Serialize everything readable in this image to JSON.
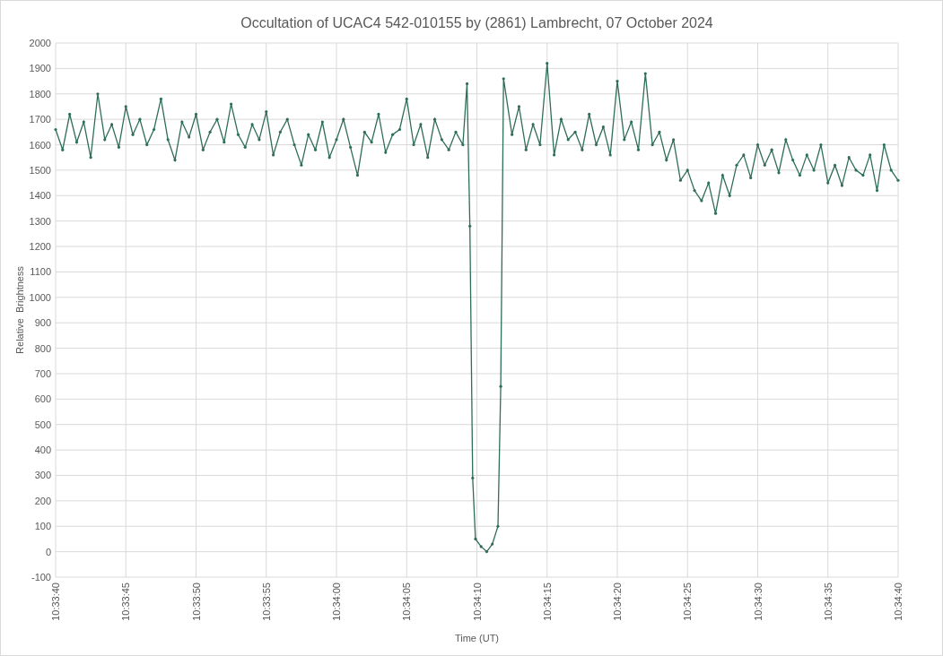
{
  "chart": {
    "chart_data": {
      "type": "line",
      "title": "Occultation of UCAC4 542-010155 by (2861) Lambrecht, 07 October 2024",
      "xlabel": "Time (UT)",
      "ylabel": "Relative  Brightness",
      "x": [
        38020,
        38020.5,
        38021,
        38021.5,
        38022,
        38022.5,
        38023,
        38023.5,
        38024,
        38024.5,
        38025,
        38025.5,
        38026,
        38026.5,
        38027,
        38027.5,
        38028,
        38028.5,
        38029,
        38029.5,
        38030,
        38030.5,
        38031,
        38031.5,
        38032,
        38032.5,
        38033,
        38033.5,
        38034,
        38034.5,
        38035,
        38035.5,
        38036,
        38036.5,
        38037,
        38037.5,
        38038,
        38038.5,
        38039,
        38039.5,
        38040,
        38040.5,
        38041,
        38041.5,
        38042,
        38042.5,
        38043,
        38043.5,
        38044,
        38044.5,
        38045,
        38045.5,
        38046,
        38046.5,
        38047,
        38047.5,
        38048,
        38048.5,
        38049,
        38049.3,
        38049.5,
        38049.7,
        38049.9,
        38050.3,
        38050.7,
        38051.1,
        38051.5,
        38051.7,
        38051.9,
        38052.5,
        38053,
        38053.5,
        38054,
        38054.5,
        38055,
        38055.5,
        38056,
        38056.5,
        38057,
        38057.5,
        38058,
        38058.5,
        38059,
        38059.5,
        38060,
        38060.5,
        38061,
        38061.5,
        38062,
        38062.5,
        38063,
        38063.5,
        38064,
        38064.5,
        38065,
        38065.5,
        38066,
        38066.5,
        38067,
        38067.5,
        38068,
        38068.5,
        38069,
        38069.5,
        38070,
        38070.5,
        38071,
        38071.5,
        38072,
        38072.5,
        38073,
        38073.5,
        38074,
        38074.5,
        38075,
        38075.5,
        38076,
        38076.5,
        38077,
        38077.5,
        38078,
        38078.5,
        38079,
        38079.5,
        38080
      ],
      "grid": true,
      "series": [
        {
          "color": "#2f6e57",
          "values": [
            1660,
            1580,
            1720,
            1610,
            1690,
            1550,
            1800,
            1620,
            1680,
            1590,
            1750,
            1640,
            1700,
            1600,
            1660,
            1780,
            1620,
            1540,
            1690,
            1630,
            1720,
            1580,
            1650,
            1700,
            1610,
            1760,
            1640,
            1590,
            1680,
            1620,
            1730,
            1560,
            1650,
            1700,
            1600,
            1520,
            1640,
            1580,
            1690,
            1550,
            1620,
            1700,
            1590,
            1480,
            1650,
            1610,
            1720,
            1570,
            1640,
            1660,
            1780,
            1600,
            1680,
            1550,
            1700,
            1620,
            1580,
            1650,
            1600,
            1840,
            1280,
            290,
            50,
            20,
            0,
            30,
            100,
            650,
            1860,
            1640,
            1750,
            1580,
            1680,
            1600,
            1920,
            1560,
            1700,
            1620,
            1650,
            1580,
            1720,
            1600,
            1670,
            1560,
            1850,
            1620,
            1690,
            1580,
            1880,
            1600,
            1650,
            1540,
            1620,
            1460,
            1500,
            1420,
            1380,
            1450,
            1330,
            1480,
            1400,
            1520,
            1560,
            1470,
            1600,
            1520,
            1580,
            1490,
            1620,
            1540,
            1480,
            1560,
            1500,
            1600,
            1450,
            1520,
            1440,
            1550,
            1500,
            1480,
            1560,
            1420,
            1600,
            1500,
            1460
          ]
        }
      ],
      "xlim": [
        38020,
        38080
      ],
      "ylim": [
        -100,
        2000
      ],
      "xticks": [
        {
          "value": 38020,
          "label": "10:33:40"
        },
        {
          "value": 38025,
          "label": "10:33:45"
        },
        {
          "value": 38030,
          "label": "10:33:50"
        },
        {
          "value": 38035,
          "label": "10:33:55"
        },
        {
          "value": 38040,
          "label": "10:34:00"
        },
        {
          "value": 38045,
          "label": "10:34:05"
        },
        {
          "value": 38050,
          "label": "10:34:10"
        },
        {
          "value": 38055,
          "label": "10:34:15"
        },
        {
          "value": 38060,
          "label": "10:34:20"
        },
        {
          "value": 38065,
          "label": "10:34:25"
        },
        {
          "value": 38070,
          "label": "10:34:30"
        },
        {
          "value": 38075,
          "label": "10:34:35"
        },
        {
          "value": 38080,
          "label": "10:34:40"
        }
      ],
      "yticks": [
        -100,
        0,
        100,
        200,
        300,
        400,
        500,
        600,
        700,
        800,
        900,
        1000,
        1100,
        1200,
        1300,
        1400,
        1500,
        1600,
        1700,
        1800,
        1900,
        2000
      ]
    }
  }
}
